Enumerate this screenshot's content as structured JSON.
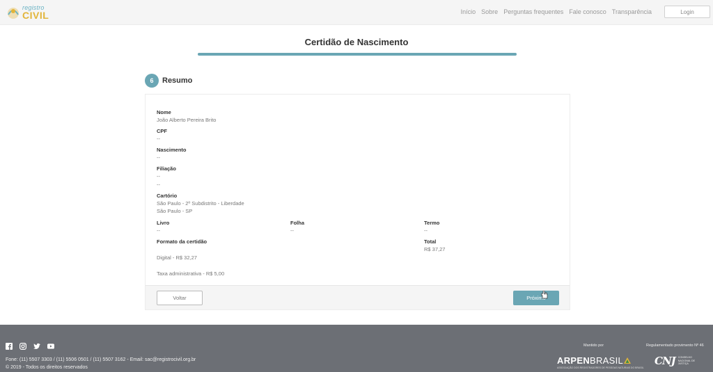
{
  "header": {
    "logo_top": "registro",
    "logo_bottom": "CIVIL",
    "nav": [
      "Início",
      "Sobre",
      "Perguntas frequentes",
      "Fale conosco",
      "Transparência"
    ],
    "login_label": "Login"
  },
  "page": {
    "title": "Certidão de Nascimento",
    "step_number": "6",
    "step_title": "Resumo"
  },
  "summary": {
    "nome_label": "Nome",
    "nome_value": "João Alberto Pereira Brito",
    "cpf_label": "CPF",
    "cpf_value": "--",
    "nascimento_label": "Nascimento",
    "nascimento_value": "--",
    "filiacao_label": "Filiação",
    "filiacao_value_1": "--",
    "filiacao_value_2": "--",
    "cartorio_label": "Cartório",
    "cartorio_line_1": "São Paulo - 2º Subdistrito - Liberdade",
    "cartorio_line_2": "São Paulo - SP",
    "livro_label": "Livro",
    "livro_value": "--",
    "folha_label": "Folha",
    "folha_value": "--",
    "termo_label": "Termo",
    "termo_value": "--",
    "formato_label": "Formato da certidão",
    "formato_digital": "Digital - R$ 32,27",
    "taxa": "Taxa administrativa - R$ 5,00",
    "total_label": "Total",
    "total_value": "R$ 37,27"
  },
  "actions": {
    "back_label": "Voltar",
    "next_label": "Próximo"
  },
  "footer": {
    "contact": "Fone: (11) 5507 3303 / (11) 5506 0501 / (11) 5507 3162 - Email: sac@registrocivil.org.br",
    "copyright": "© 2019 - Todos os direitos reservados",
    "mantido_por": "Mantido por",
    "regulamentado": "Regulamentado provimento Nº 46",
    "arpen_a": "ARPEN",
    "arpen_b": "BRASIL",
    "arpen_sub": "ASSOCIAÇÃO DOS REGISTRADORES DE PESSOAS NATURAIS DO BRASIL",
    "cnj_mark": "CNJ",
    "cnj_text": "CONSELHO NACIONAL DE JUSTIÇA"
  },
  "colors": {
    "accent": "#6aa6b4",
    "footer_bg": "#6c6f75",
    "logo_yellow": "#e2b53a"
  },
  "icons": [
    "facebook-icon",
    "instagram-icon",
    "twitter-icon",
    "youtube-icon",
    "cursor-icon"
  ]
}
